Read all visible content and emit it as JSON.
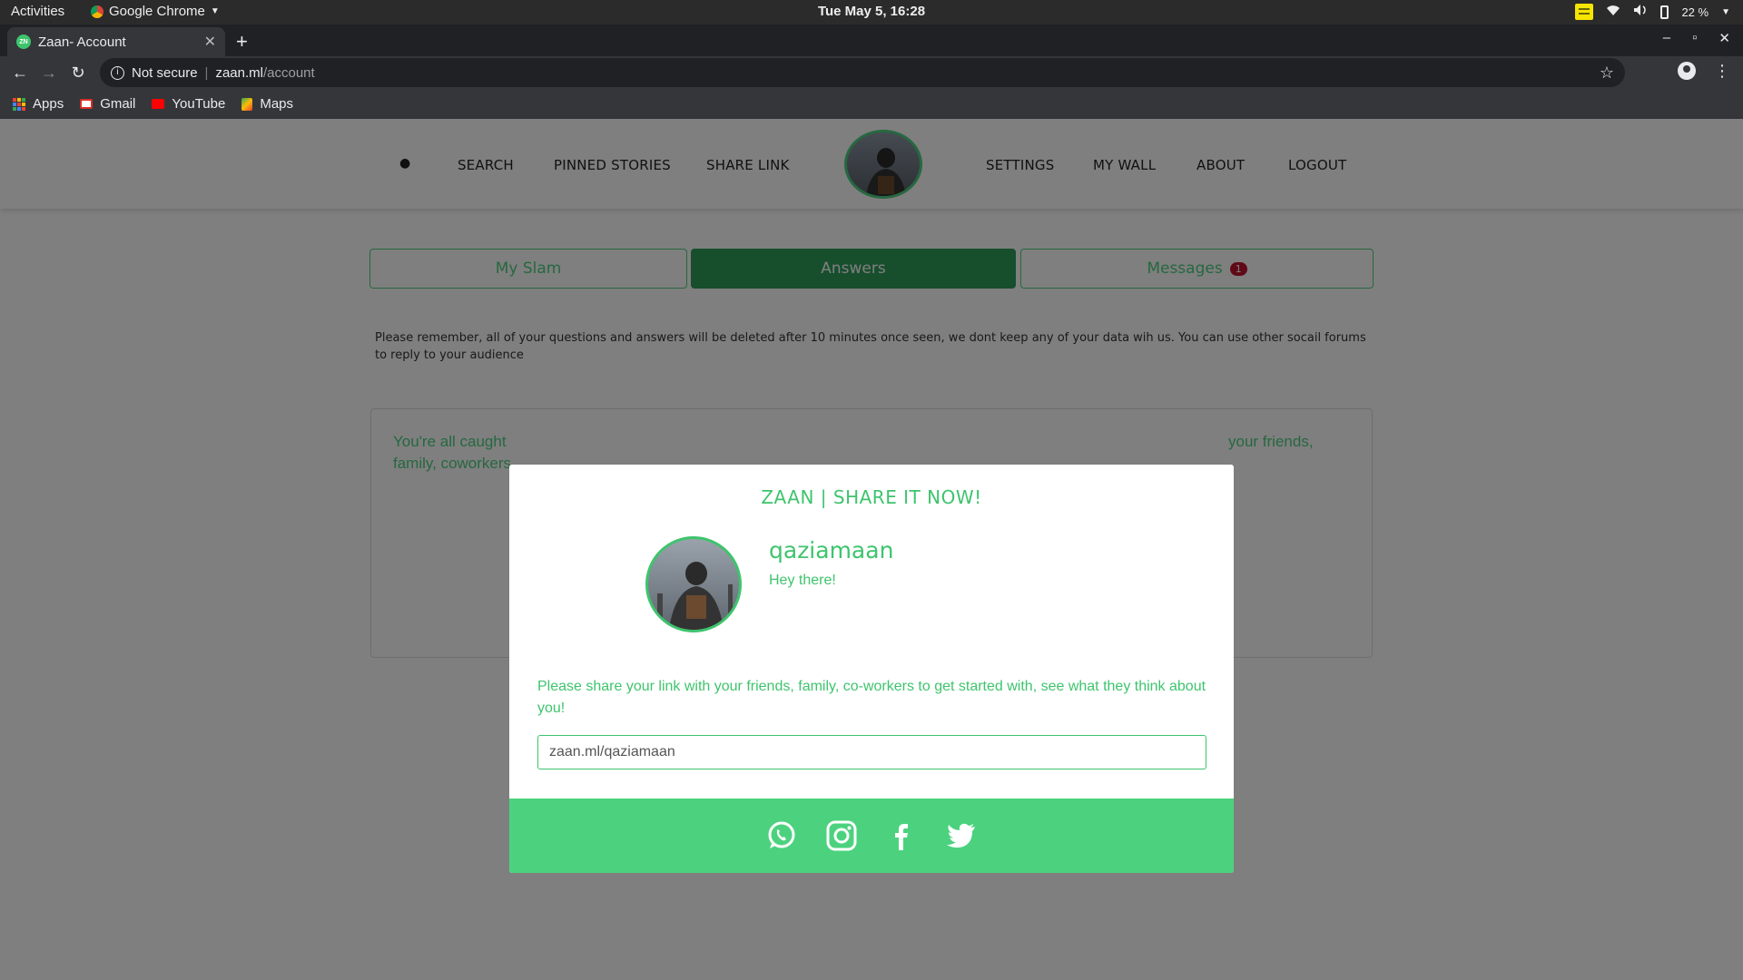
{
  "system": {
    "activities": "Activities",
    "app_name": "Google Chrome",
    "clock": "Tue May  5, 16:28",
    "battery": "22 %"
  },
  "browser": {
    "tab_title": "Zaan- Account",
    "security": "Not secure",
    "url_host": "zaan.ml",
    "url_path": "/account",
    "bookmarks": [
      "Apps",
      "Gmail",
      "YouTube",
      "Maps"
    ]
  },
  "site_nav": {
    "items_left": [
      "SEARCH",
      "PINNED STORIES",
      "SHARE LINK"
    ],
    "items_right": [
      "SETTINGS",
      "MY WALL",
      "ABOUT",
      "LOGOUT"
    ]
  },
  "tabs": {
    "my_slam": "My Slam",
    "answers": "Answers",
    "messages": "Messages",
    "messages_badge": "1"
  },
  "notice": "Please remember, all of your questions and answers will be deleted after 10 minutes once seen, we dont keep any of your data wih us. You can use other socail forums to reply to your audience",
  "feed": {
    "text_left": "You're all caught",
    "text_left_2": "family, coworkers",
    "text_right": "your friends,"
  },
  "modal": {
    "title": "ZAAN | SHARE IT NOW!",
    "username": "qaziamaan",
    "bio": "Hey there!",
    "share_text": "Please share your link with your friends, family, co-workers to get started with, see what they think about you!",
    "share_link": "zaan.ml/qaziamaan",
    "social": [
      "whatsapp-icon",
      "instagram-icon",
      "facebook-icon",
      "twitter-icon"
    ]
  },
  "colors": {
    "brand_green": "#3ec46d",
    "footer_green": "#4cd27e",
    "active_tab": "#2f9e5a",
    "badge_red": "#c0152f"
  }
}
